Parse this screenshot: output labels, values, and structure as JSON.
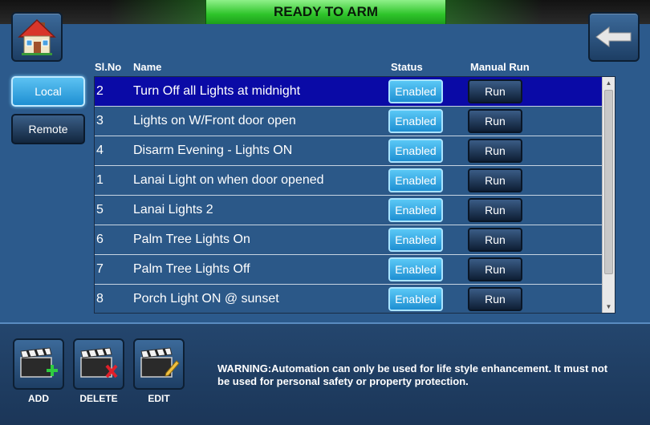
{
  "header": {
    "status_text": "READY TO ARM",
    "home_icon": "home-icon",
    "back_icon": "back-arrow-icon"
  },
  "sidebar": {
    "local_label": "Local",
    "remote_label": "Remote"
  },
  "table": {
    "headers": {
      "slno": "Sl.No",
      "name": "Name",
      "status": "Status",
      "manual_run": "Manual Run"
    },
    "rows": [
      {
        "no": "2",
        "name": "Turn Off all Lights at midnight",
        "status": "Enabled",
        "run": "Run"
      },
      {
        "no": "3",
        "name": "Lights on W/Front door open",
        "status": "Enabled",
        "run": "Run"
      },
      {
        "no": "4",
        "name": "Disarm Evening - Lights ON",
        "status": "Enabled",
        "run": "Run"
      },
      {
        "no": "1",
        "name": "Lanai Light on when door opened",
        "status": "Enabled",
        "run": "Run"
      },
      {
        "no": "5",
        "name": "Lanai Lights 2",
        "status": "Enabled",
        "run": "Run"
      },
      {
        "no": "6",
        "name": "Palm Tree Lights On",
        "status": "Enabled",
        "run": "Run"
      },
      {
        "no": "7",
        "name": "Palm Tree Lights Off",
        "status": "Enabled",
        "run": "Run"
      },
      {
        "no": "8",
        "name": "Porch Light ON @ sunset",
        "status": "Enabled",
        "run": "Run"
      }
    ]
  },
  "footer": {
    "add_label": "ADD",
    "delete_label": "DELETE",
    "edit_label": "EDIT",
    "warning": "WARNING:Automation can only be used for life style enhancement. It must not be used for personal safety or property protection."
  },
  "colors": {
    "background": "#2c5a8c",
    "selected_row": "#0a0aa6",
    "banner_green": "#2ec42a",
    "enabled_blue": "#1e8fd2"
  }
}
